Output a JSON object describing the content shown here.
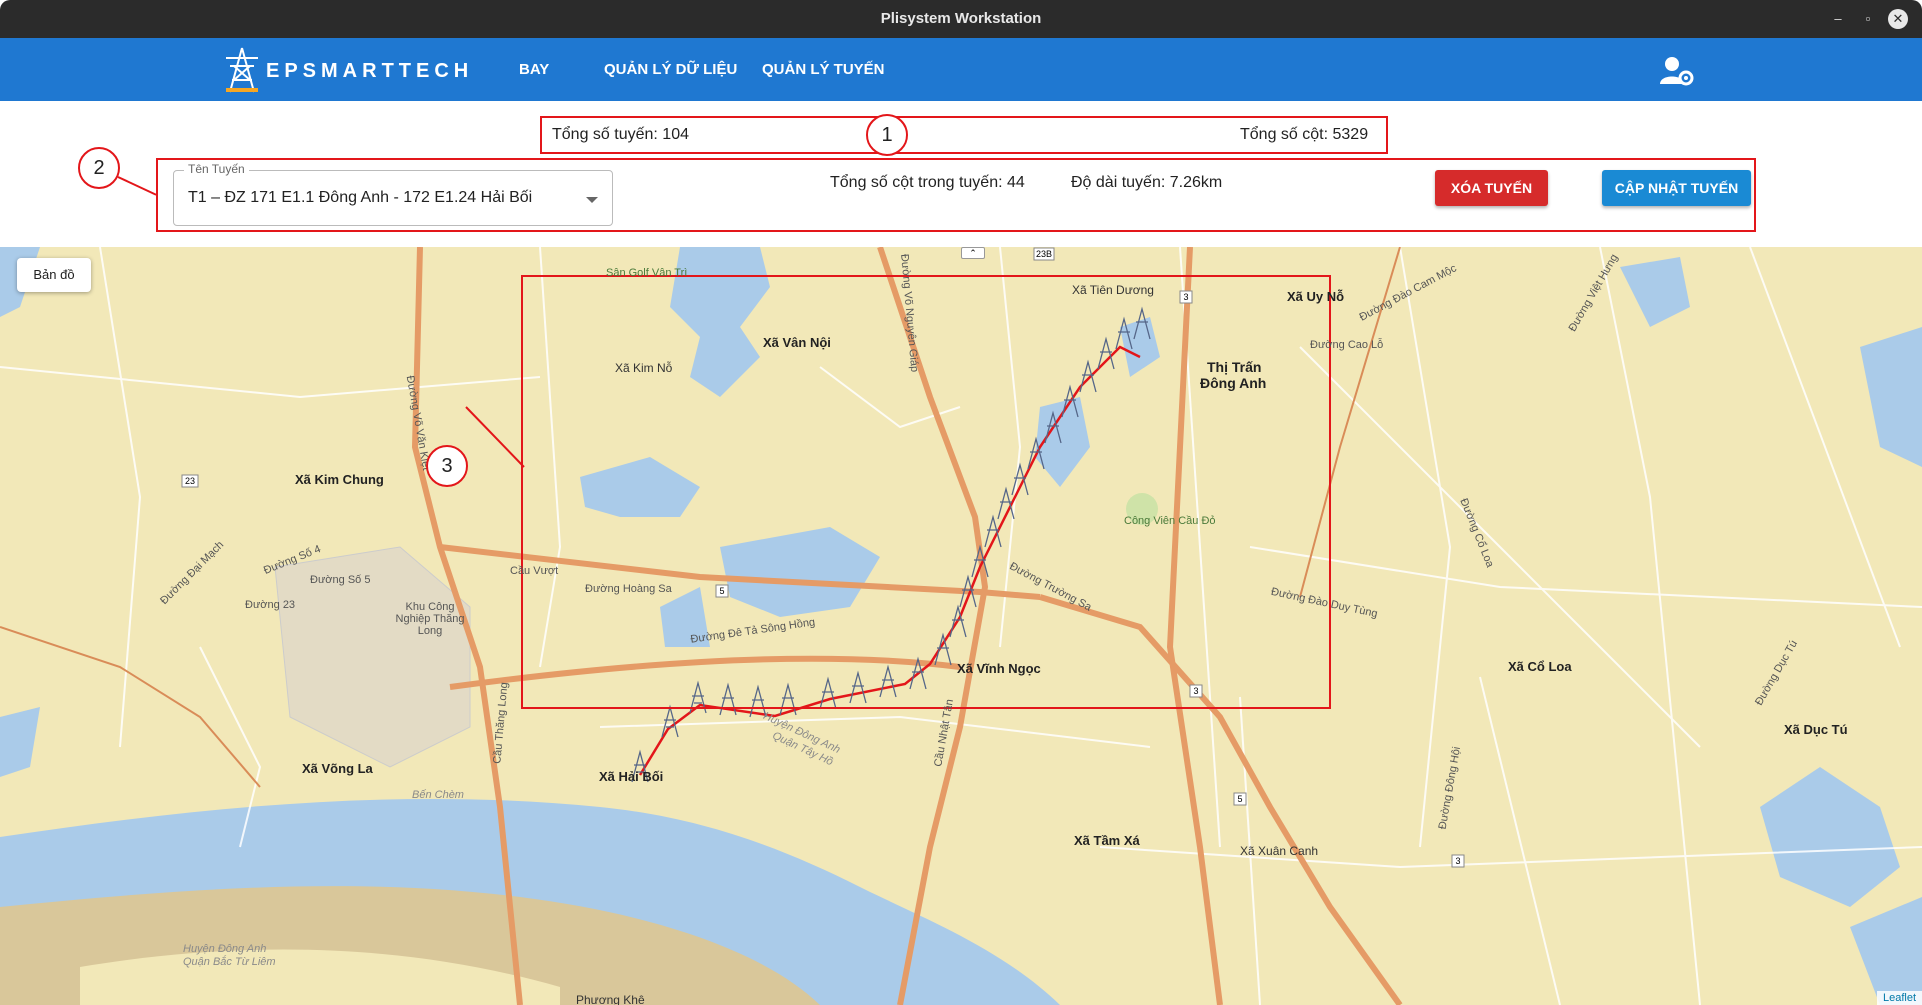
{
  "window": {
    "title": "Plisystem Workstation",
    "minimize": "–",
    "maximize": "▫",
    "close": "✕"
  },
  "nav": {
    "brand": "EPSMARTTECH",
    "links": [
      "BAY",
      "QUẢN LÝ DỮ LIỆU",
      "QUẢN LÝ TUYẾN"
    ]
  },
  "summary": {
    "total_routes": "Tổng số tuyến: 104",
    "total_poles": "Tổng số cột: 5329"
  },
  "route": {
    "select_label": "Tên Tuyến",
    "select_value": "T1 – ĐZ 171 E1.1 Đông Anh - 172 E1.24 Hải Bối",
    "poles_in_route": "Tổng số cột trong tuyến: 44",
    "route_length": "Độ dài tuyến: 7.26km",
    "delete_label": "XÓA TUYẾN",
    "update_label": "CẬP NHẬT TUYẾN"
  },
  "annotations": [
    "1",
    "2",
    "3"
  ],
  "map": {
    "basemap_label": "Bản đồ",
    "collapse_label": "⌃",
    "attribution": "Leaflet",
    "places": [
      "Xã Tiên Dương",
      "Xã Uy Nỗ",
      "Xã Vân Nội",
      "Xã Kim Nỗ",
      "Thị Trấn",
      "Đông Anh",
      "Xã Kim Chung",
      "Xã Vĩnh Ngọc",
      "Xã Cổ Loa",
      "Xã Dục Tú",
      "Xã Võng La",
      "Xã Tầm Xá",
      "Xã Xuân Canh",
      "Xã Hải Bối",
      "Phương Khê"
    ],
    "roads": [
      "Đường Hoàng Sa",
      "Cầu Vượt",
      "Đường Trường Sa",
      "Đường Võ Nguyên Giáp",
      "Đường Đê Tả Sông Hồng",
      "Đường Đào Duy Tùng",
      "Đường Cổ Loa",
      "Đường Đào Cam Mộc",
      "Đường Cao Lỗ",
      "Đường Việt Hưng",
      "Đường Đại Mạch",
      "Đường Số 4",
      "Đường Số 5",
      "Đường 23",
      "Đường Võ Văn Kiệt",
      "Cầu Thăng Long",
      "Cầu Nhật Tân",
      "Đường Đông Hội",
      "Đường Dục Tú"
    ],
    "pois": [
      "Công Viên Cầu Đỏ",
      "Khu Công Nghiệp Thăng Long",
      "Sân Golf Vân Trì"
    ],
    "water": [
      "Huyện Đông Anh",
      "Quận Tây Hồ",
      "Bến Chèm",
      "Huyện Đông Anh",
      "Quận Bắc Từ Liêm"
    ],
    "shields": [
      "23",
      "5",
      "3",
      "23B"
    ]
  },
  "colors": {
    "navbar": "#1f78d1",
    "annotation": "#e3161a",
    "route_line": "#e3161a",
    "map_land": "#f2e8b8",
    "water": "#aacbe9"
  }
}
